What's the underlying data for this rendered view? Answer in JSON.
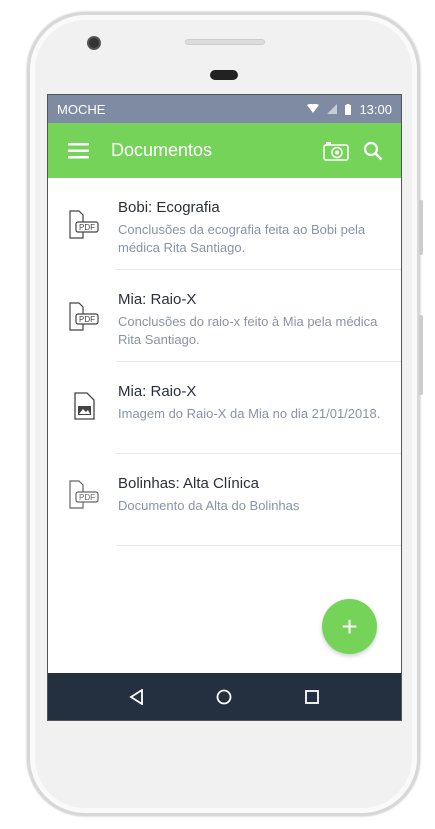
{
  "status": {
    "carrier": "MOCHE",
    "time": "13:00"
  },
  "appbar": {
    "title": "Documentos"
  },
  "documents": [
    {
      "title": "Bobi: Ecografia",
      "description": "Conclusões da ecografia feita ao Bobi pela médica Rita Santiago.",
      "icon": "pdf-file-icon"
    },
    {
      "title": "Mia: Raio-X",
      "description": "Conclusões do raio-x feito à Mia pela médica Rita Santiago.",
      "icon": "pdf-file-icon"
    },
    {
      "title": "Mia: Raio-X",
      "description": "Imagem do Raio-X da Mia no dia 21/01/2018.",
      "icon": "image-file-icon"
    },
    {
      "title": "Bolinhas: Alta Clínica",
      "description": "Documento da Alta do Bolinhas",
      "icon": "pdf-file-icon"
    }
  ],
  "fab": {
    "label": "+"
  },
  "colors": {
    "accent": "#76d35a",
    "status": "#7f8ba3",
    "nav": "#243040"
  }
}
